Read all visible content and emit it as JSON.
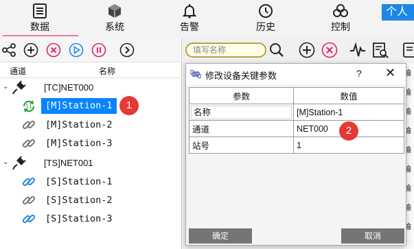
{
  "nav": {
    "items": [
      {
        "label": "数据",
        "icon": "data-list-icon"
      },
      {
        "label": "系统",
        "icon": "cube-icon"
      },
      {
        "label": "告警",
        "icon": "bell-icon"
      },
      {
        "label": "历史",
        "icon": "history-icon"
      },
      {
        "label": "控制",
        "icon": "biohazard-icon"
      }
    ],
    "user_button": "个人"
  },
  "left_panel": {
    "columns": [
      "通道",
      "名称"
    ],
    "channels": [
      {
        "label": "[TC]NET000",
        "stations": [
          "[M]Station-1",
          "[M]Station-2",
          "[M]Station-3"
        ]
      },
      {
        "label": "[TS]NET001",
        "stations": [
          "[S]Station-1",
          "[S]Station-2",
          "[S]Station-3"
        ]
      }
    ],
    "selected": "[M]Station-1"
  },
  "right_panel": {
    "search_placeholder": "填写名称",
    "strip_text": [
      "输",
      "输",
      "输",
      "输",
      "输",
      "输",
      "输",
      "输",
      "输"
    ]
  },
  "dialog": {
    "title": "修改设备关键参数",
    "help": "?",
    "close": "✕",
    "headers": [
      "参数",
      "数值"
    ],
    "rows": [
      {
        "param": "名称",
        "value": "[M]Station-1"
      },
      {
        "param": "通道",
        "value": "NET000"
      },
      {
        "param": "站号",
        "value": "1"
      }
    ],
    "ok": "确定",
    "cancel": "取消"
  },
  "markers": [
    "1",
    "2"
  ],
  "colors": {
    "accent": "#0a84ff",
    "marker": "#e53935",
    "search_border": "#b8a43a"
  }
}
